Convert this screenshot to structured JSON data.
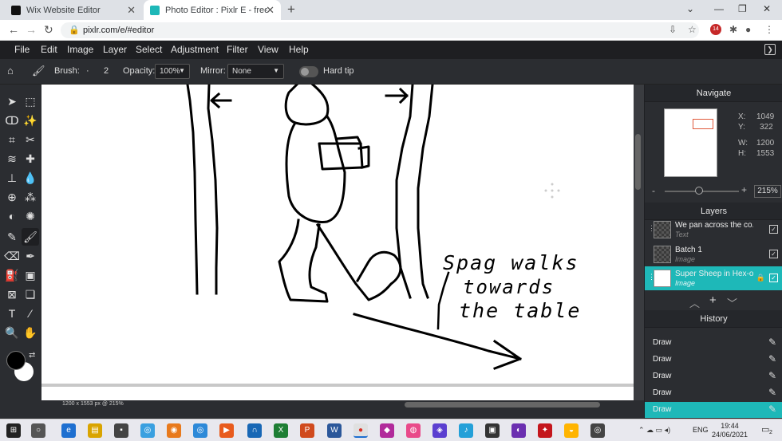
{
  "browser": {
    "tabs": [
      {
        "title": "Wix Website Editor",
        "active": false
      },
      {
        "title": "Photo Editor : Pixlr E - free image",
        "active": true
      }
    ],
    "new_tab": "+",
    "url": "pixlr.com/e/#editor",
    "profile_badge": "14"
  },
  "menu": [
    "File",
    "Edit",
    "Image",
    "Layer",
    "Select",
    "Adjustment",
    "Filter",
    "View",
    "Help"
  ],
  "options": {
    "brush_label": "Brush:",
    "brush_dot": "·",
    "brush_size": "2",
    "opacity_label": "Opacity:",
    "opacity_value": "100%",
    "mirror_label": "Mirror:",
    "mirror_value": "None",
    "hardtip_label": "Hard tip"
  },
  "canvas": {
    "handwriting": [
      "Spag walks",
      "towards",
      "the table"
    ]
  },
  "status": {
    "text": "1200 x 1553 px @ 215%"
  },
  "navigate": {
    "title": "Navigate",
    "x_label": "X:",
    "x": "1049",
    "y_label": "Y:",
    "y": "322",
    "w_label": "W:",
    "w": "1200",
    "h_label": "H:",
    "h": "1553",
    "zoom": "215%",
    "minus": "-",
    "plus": "+"
  },
  "layers": {
    "title": "Layers",
    "items": [
      {
        "name": "We pan across the co...",
        "kind": "Text"
      },
      {
        "name": "Batch 1",
        "kind": "Image"
      },
      {
        "name": "Super Sheep in Hex-o'...",
        "kind": "Image"
      }
    ]
  },
  "history": {
    "title": "History",
    "items": [
      "Draw",
      "Draw",
      "Draw",
      "Draw",
      "Draw"
    ]
  },
  "taskbar": {
    "time": "19:44",
    "date": "24/06/2021",
    "lang": "ENG",
    "notif": "2"
  },
  "colors": {
    "accent": "#1eb8b8",
    "panel": "#2b2d31",
    "menubar": "#1e1f22"
  }
}
